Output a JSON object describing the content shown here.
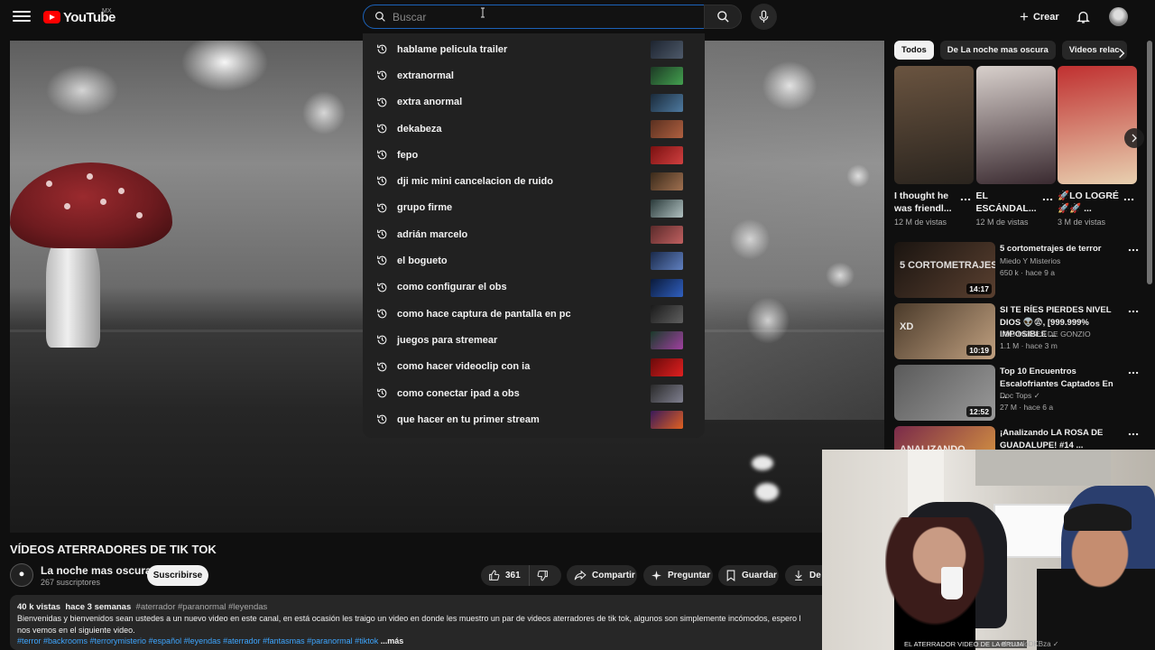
{
  "header": {
    "logo_text": "YouTube",
    "country_code": "MX",
    "search_placeholder": "Buscar",
    "create_label": "Crear"
  },
  "suggestions": [
    {
      "text": "hablame pelicula trailer",
      "thumb_colors": [
        "#1d2430",
        "#4e5a6a"
      ]
    },
    {
      "text": "extranormal",
      "thumb_colors": [
        "#1c3a24",
        "#43a04f"
      ]
    },
    {
      "text": "extra anormal",
      "thumb_colors": [
        "#1a2a3a",
        "#4e7aa0"
      ]
    },
    {
      "text": "dekabeza",
      "thumb_colors": [
        "#5a3020",
        "#b06040"
      ]
    },
    {
      "text": "fepo",
      "thumb_colors": [
        "#7a1010",
        "#d04040"
      ]
    },
    {
      "text": "dji mic mini cancelacion de ruido",
      "thumb_colors": [
        "#3a2a1a",
        "#a07050"
      ]
    },
    {
      "text": "grupo firme",
      "thumb_colors": [
        "#2a3a3a",
        "#b0c0c0"
      ]
    },
    {
      "text": "adrián marcelo",
      "thumb_colors": [
        "#5a2a2a",
        "#c06060"
      ]
    },
    {
      "text": "el bogueto",
      "thumb_colors": [
        "#1a2a4a",
        "#6080c0"
      ]
    },
    {
      "text": "como configurar el obs",
      "thumb_colors": [
        "#0a1a3a",
        "#3060c0"
      ]
    },
    {
      "text": "como hace captura de pantalla en pc",
      "thumb_colors": [
        "#1a1a1a",
        "#606060"
      ]
    },
    {
      "text": "juegos para stremear",
      "thumb_colors": [
        "#1a3a2a",
        "#a040a0"
      ]
    },
    {
      "text": "como hacer videoclip con ia",
      "thumb_colors": [
        "#6a0a0a",
        "#e02020"
      ]
    },
    {
      "text": "como conectar ipad a obs",
      "thumb_colors": [
        "#2a2a2a",
        "#808090"
      ]
    },
    {
      "text": "que hacer en tu primer stream",
      "thumb_colors": [
        "#3a1a5a",
        "#e06020"
      ]
    }
  ],
  "video": {
    "title": "VÍDEOS ATERRADORES DE TIK TOK",
    "channel": "La noche mas oscura",
    "subscribers": "267 suscriptores",
    "subscribe_label": "Suscribirse",
    "likes": "361",
    "share_label": "Compartir",
    "ask_label": "Preguntar",
    "save_label": "Guardar",
    "download_label": "De",
    "views": "40 k vistas",
    "published": "hace 3 semanas",
    "hashtags_top": "#aterrador #paranormal #leyendas",
    "description_line1": "Bienvenidas y bienvenidos sean ustedes a un nuevo video en este canal, en está ocasión les traigo un video en donde les muestro un par de videos aterradores de tik tok, algunos son simplemente incómodos, espero l",
    "description_line2": "nos vemos en el siguiente video.",
    "hashtags_bottom": "#terror #backrooms #terrorymisterio #español #leyendas #aterrador #fantasmas #paranormal #tiktok",
    "more_label": "...más"
  },
  "sidebar": {
    "chips": [
      "Todos",
      "De La noche mas oscura",
      "Videos relac"
    ],
    "shorts": [
      {
        "title": "I thought he was friendl...",
        "views": "12 M de vistas",
        "colors": [
          "#6a5440",
          "#2a241e"
        ]
      },
      {
        "title": "EL ESCÁNDAL...",
        "views": "12 M de vistas",
        "colors": [
          "#d8d0cc",
          "#3a2a30"
        ]
      },
      {
        "title": "🚀LO LOGRÉ 🚀🚀 ...",
        "views": "3 M de vistas",
        "colors": [
          "#c03030",
          "#e8d0b0"
        ]
      }
    ],
    "recommended": [
      {
        "title": "5 cortometrajes de terror",
        "channel": "Miedo Y Misterios",
        "stats": "650 k · hace 9 a",
        "duration": "14:17",
        "thumb_text": "5 CORTOMETRAJES DE TERROR",
        "colors": [
          "#1a1410",
          "#5a4030"
        ]
      },
      {
        "title": "SI TE RÍES PIERDES NIVEL DIOS 👽😨, [999.999% IMPOSIBLE ...",
        "channel": "LOS MEMES DE GONZIO",
        "stats": "1.1 M · hace 3 m",
        "duration": "10:19",
        "thumb_text": "XD",
        "colors": [
          "#4a3a2a",
          "#c0a080"
        ]
      },
      {
        "title": "Top 10 Encuentros Escalofriantes Captados En ...",
        "channel": "Doc Tops ✓",
        "stats": "27 M · hace 6 a",
        "duration": "12:52",
        "thumb_text": "",
        "colors": [
          "#5a5a5a",
          "#9a9a9a"
        ]
      },
      {
        "title": "¡Analizando LA ROSA DE GUADALUPE! #14 ...",
        "channel": "",
        "stats": "",
        "duration": "",
        "thumb_text": "ANALIZANDO",
        "colors": [
          "#7a2a4a",
          "#e0a040"
        ]
      }
    ]
  },
  "webcam": {
    "caption_left": "EL ATERRADOR VIDEO DE LA BRUJA",
    "caption_right": "elmundoDKBza ✓"
  }
}
